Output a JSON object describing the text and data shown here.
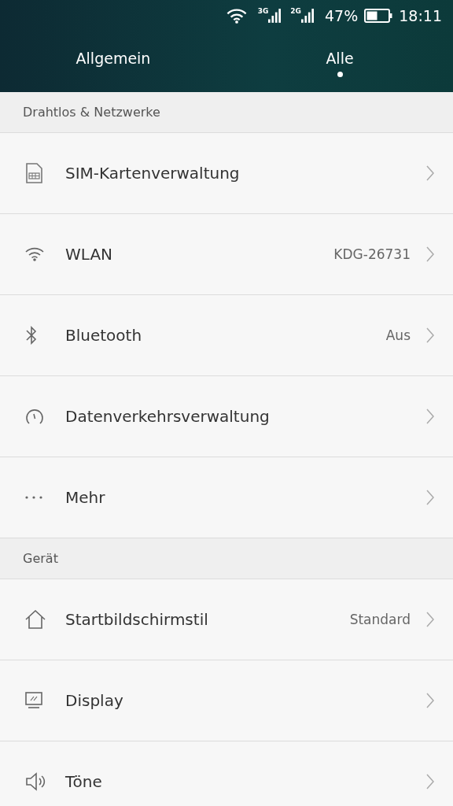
{
  "status_bar": {
    "signals": [
      {
        "network": "3G"
      },
      {
        "network": "2G"
      }
    ],
    "battery": "47%",
    "time": "18:11"
  },
  "tabs": [
    {
      "label": "Allgemein",
      "selected": false
    },
    {
      "label": "Alle",
      "selected": true
    }
  ],
  "sections": [
    {
      "title": "Drahtlos & Netzwerke",
      "items": [
        {
          "label": "SIM-Kartenverwaltung"
        },
        {
          "label": "WLAN",
          "value": "KDG-26731"
        },
        {
          "label": "Bluetooth",
          "value": "Aus"
        },
        {
          "label": "Datenverkehrsverwaltung"
        },
        {
          "label": "Mehr"
        }
      ]
    },
    {
      "title": "Gerät",
      "items": [
        {
          "label": "Startbildschirmstil",
          "value": "Standard"
        },
        {
          "label": "Display"
        },
        {
          "label": "Töne"
        }
      ]
    }
  ]
}
